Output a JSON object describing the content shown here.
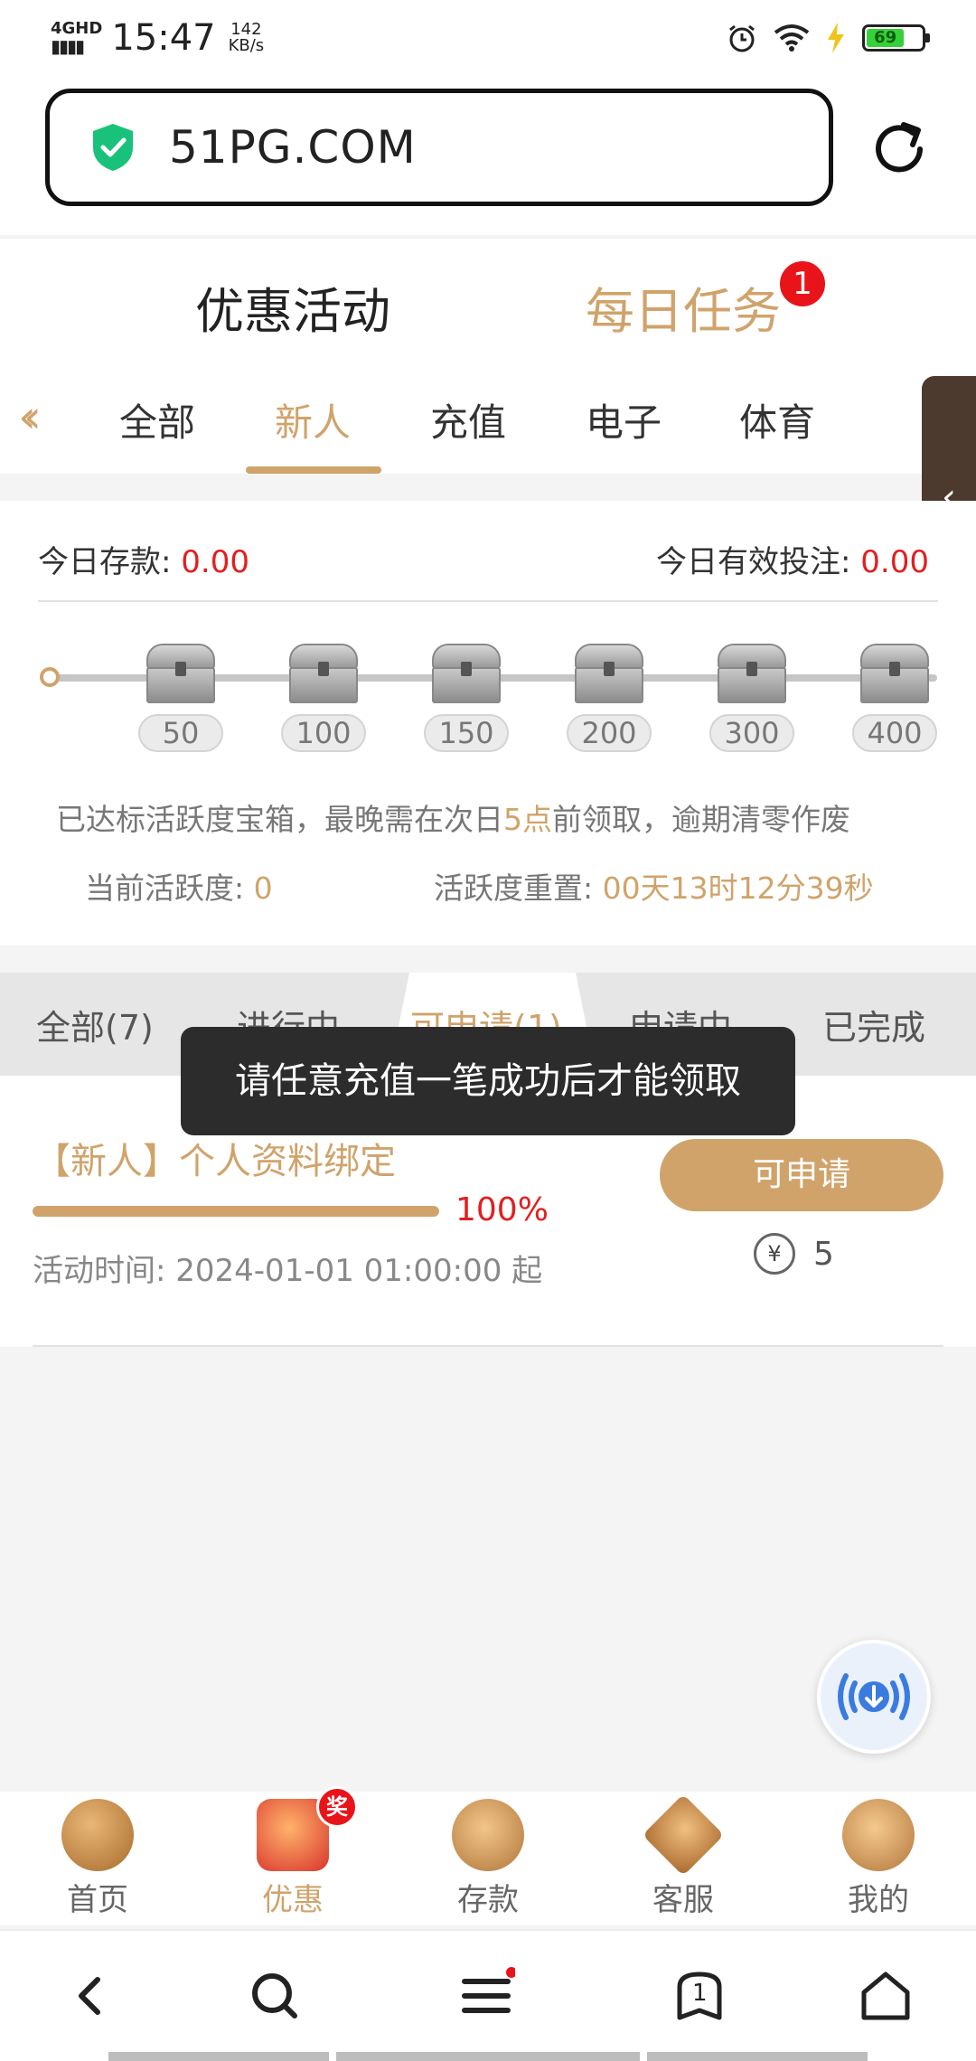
{
  "status_bar": {
    "network": "4GHD",
    "time": "15:47",
    "speed_value": "142",
    "speed_unit": "KB/s",
    "battery": "69"
  },
  "browser": {
    "url": "51PG.COM"
  },
  "top_tabs": {
    "promotions": "优惠活动",
    "daily_tasks": "每日任务",
    "daily_tasks_badge": "1"
  },
  "categories": {
    "items": [
      "全部",
      "新人",
      "充值",
      "电子",
      "体育"
    ],
    "active_index": 1
  },
  "activity": {
    "deposit_label": "今日存款: ",
    "deposit_value": "0.00",
    "bet_label": "今日有效投注: ",
    "bet_value": "0.00",
    "milestones": [
      "50",
      "100",
      "150",
      "200",
      "300",
      "400"
    ],
    "notice_prefix": "已达标活跃度宝箱，最晚需在次日",
    "notice_highlight": "5点",
    "notice_suffix": "前领取，逾期清零作废",
    "current_label": "当前活跃度: ",
    "current_value": "0",
    "reset_label": "活跃度重置: ",
    "reset_value": "00天13时12分39秒"
  },
  "status_tabs": {
    "items": [
      "全部(7)",
      "进行中",
      "可申请(1)",
      "申请中",
      "已完成"
    ],
    "active_index": 2
  },
  "toast": "请任意充值一笔成功后才能领取",
  "task": {
    "title": "【新人】个人资料绑定",
    "progress_pct": 100,
    "progress_label": "100%",
    "time": "活动时间: 2024-01-01 01:00:00 起",
    "button": "可申请",
    "reward": "5",
    "reward_icon": "¥"
  },
  "app_nav": {
    "items": [
      "首页",
      "优惠",
      "存款",
      "客服",
      "我的"
    ],
    "active_index": 1,
    "badge": "奖"
  },
  "browser_nav": {
    "tabs_count": "1"
  },
  "colors": {
    "accent": "#d0a36b",
    "red": "#e02020",
    "handle": "#4b3a2d"
  }
}
